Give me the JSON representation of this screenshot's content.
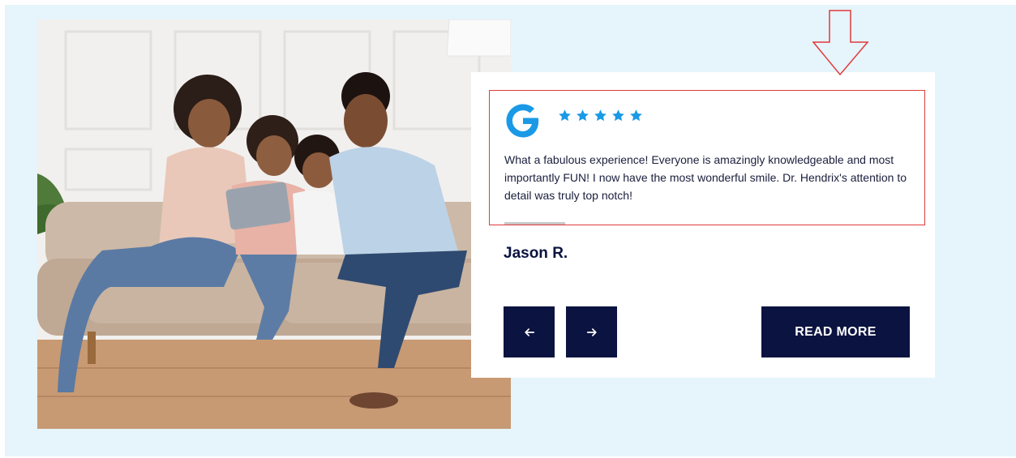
{
  "review": {
    "source_icon": "google-g-icon",
    "rating": 5,
    "text": "What a fabulous experience! Everyone is amazingly knowledgeable and most importantly FUN! I now have the most wonderful smile. Dr. Hendrix's attention to detail was truly top notch!",
    "reviewer": "Jason R.",
    "slider_progress": 0.15
  },
  "controls": {
    "prev_icon": "arrow-left-icon",
    "next_icon": "arrow-right-icon",
    "read_more_label": "READ MORE"
  },
  "colors": {
    "section_bg": "#e6f4fb",
    "navy": "#0b1340",
    "star_blue": "#1a9ae6",
    "google_blue": "#1a9ae6",
    "annotation_red": "#e23a3a"
  },
  "photo": {
    "subject": "family-photo"
  }
}
